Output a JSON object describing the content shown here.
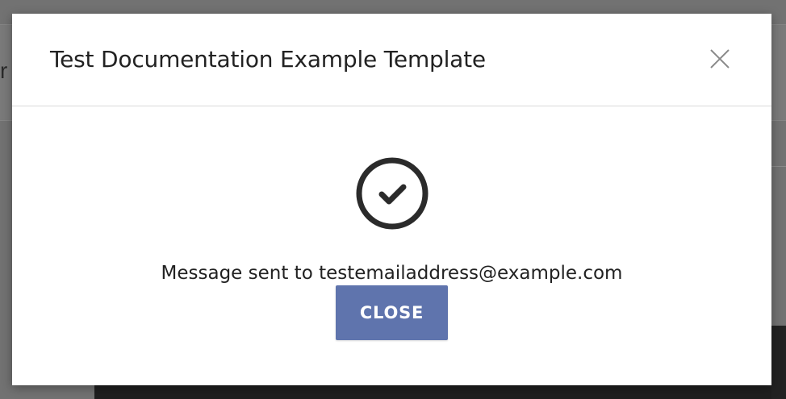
{
  "background": {
    "partial_text": "r"
  },
  "modal": {
    "title": "Test Documentation Example Template",
    "close_icon": "close-icon",
    "status_icon": "check-circle-icon",
    "message": "Message sent to testemailaddress@example.com",
    "close_button_label": "CLOSE"
  },
  "colors": {
    "button_bg": "#5f74ad",
    "overlay": "#727272",
    "icon_stroke": "#2b2b2b"
  }
}
